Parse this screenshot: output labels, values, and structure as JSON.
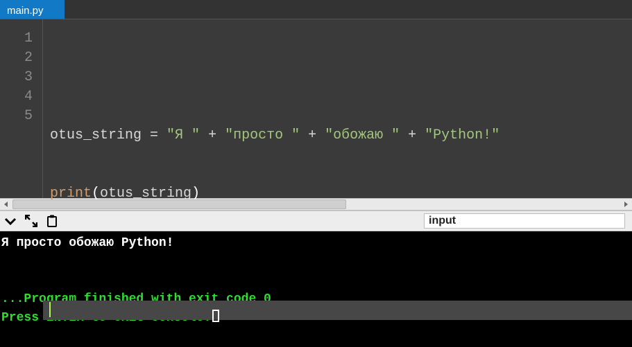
{
  "tab": {
    "filename": "main.py"
  },
  "editor": {
    "gutter": [
      "1",
      "2",
      "3",
      "4",
      "5"
    ],
    "line2": {
      "var": "otus_string",
      "eq": " = ",
      "s1": "\"Я \"",
      "p1": " + ",
      "s2": "\"просто \"",
      "p2": " + ",
      "s3": "\"обожаю \"",
      "p3": " + ",
      "s4": "\"Python!\""
    },
    "line3": {
      "fn": "print",
      "lp": "(",
      "arg": "otus_string",
      "rp": ")"
    }
  },
  "consolebar": {
    "input_value": "input"
  },
  "console": {
    "out1": "Я просто обожаю Python!",
    "blank1": "",
    "blank2": "",
    "done": "...Program finished with exit code 0",
    "press": "Press ENTER to exit console."
  }
}
